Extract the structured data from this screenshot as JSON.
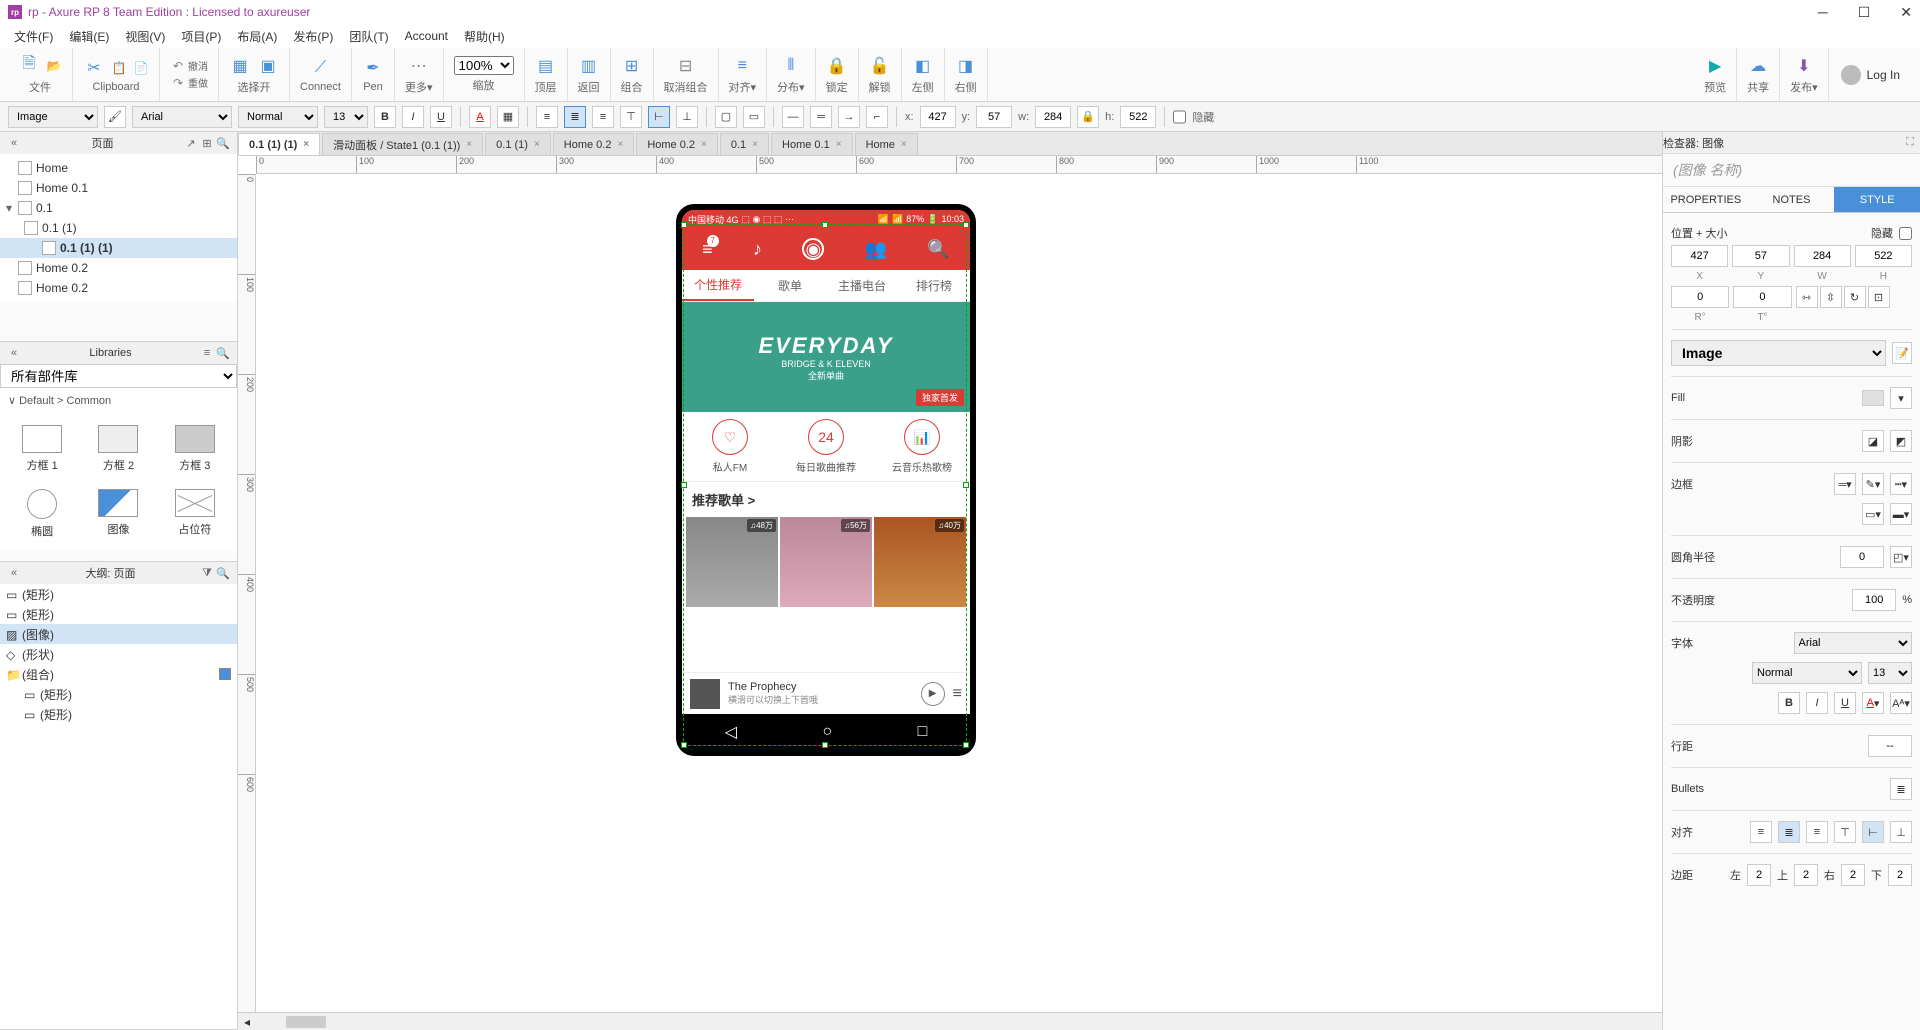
{
  "title": "rp - Axure RP 8 Team Edition : Licensed to axureuser",
  "menu": [
    "文件(F)",
    "编辑(E)",
    "视图(V)",
    "项目(P)",
    "布局(A)",
    "发布(P)",
    "团队(T)",
    "Account",
    "帮助(H)"
  ],
  "toolbar": {
    "groups": [
      {
        "label": "文件"
      },
      {
        "label": "Clipboard"
      },
      {
        "label": "选择开"
      },
      {
        "label": "Connect"
      },
      {
        "label": "Pen"
      },
      {
        "label": "更多▾"
      },
      {
        "label": "缩放"
      },
      {
        "label": "顶层"
      },
      {
        "label": "返回"
      },
      {
        "label": "组合"
      },
      {
        "label": "取消组合"
      },
      {
        "label": "对齐▾"
      },
      {
        "label": "分布▾"
      },
      {
        "label": "锁定"
      },
      {
        "label": "解锁"
      },
      {
        "label": "左侧"
      },
      {
        "label": "右侧"
      },
      {
        "label": "预览"
      },
      {
        "label": "共享"
      },
      {
        "label": "发布▾"
      }
    ],
    "zoom": "100%",
    "login": "Log In",
    "undo": "撤消",
    "redo": "重做"
  },
  "stylebar": {
    "widget": "Image",
    "font": "Arial",
    "weight": "Normal",
    "size": "13",
    "x": "427",
    "y": "57",
    "w": "284",
    "h": "522",
    "xlbl": "x:",
    "ylbl": "y:",
    "wlbl": "w:",
    "hlbl": "h:",
    "lock": "🔒",
    "hide": "隐藏"
  },
  "pages": {
    "title": "页面",
    "nodes": [
      {
        "label": "Home",
        "indent": 0
      },
      {
        "label": "Home 0.1",
        "indent": 0
      },
      {
        "label": "0.1",
        "indent": 0,
        "arrow": "▾"
      },
      {
        "label": "0.1 (1)",
        "indent": 1
      },
      {
        "label": "0.1 (1) (1)",
        "indent": 2,
        "selected": true
      },
      {
        "label": "Home 0.2",
        "indent": 0
      },
      {
        "label": "Home 0.2",
        "indent": 0
      }
    ]
  },
  "libraries": {
    "title": "Libraries",
    "select": "所有部件库",
    "section": "Default > Common",
    "items": [
      {
        "lbl": "方框 1",
        "cls": ""
      },
      {
        "lbl": "方框 2",
        "cls": "gray"
      },
      {
        "lbl": "方框 3",
        "cls": "dark"
      },
      {
        "lbl": "椭圆",
        "cls": "circle"
      },
      {
        "lbl": "图像",
        "cls": "image"
      },
      {
        "lbl": "占位符",
        "cls": "placeholder"
      }
    ]
  },
  "outline": {
    "title": "大纲: 页面",
    "nodes": [
      {
        "label": "(矩形)"
      },
      {
        "label": "(矩形)"
      },
      {
        "label": "(图像)",
        "selected": true
      },
      {
        "label": "(形状)"
      },
      {
        "label": "(组合)",
        "chk": true
      },
      {
        "label": "(矩形)",
        "indent": 1
      },
      {
        "label": "(矩形)",
        "indent": 1
      }
    ]
  },
  "tabs": [
    {
      "label": "0.1 (1) (1)",
      "active": true
    },
    {
      "label": "滑动面板 / State1 (0.1 (1))"
    },
    {
      "label": "0.1 (1)"
    },
    {
      "label": "Home 0.2"
    },
    {
      "label": "Home 0.2"
    },
    {
      "label": "0.1"
    },
    {
      "label": "Home 0.1"
    },
    {
      "label": "Home"
    }
  ],
  "rulerH": [
    "0",
    "100",
    "200",
    "300",
    "400",
    "500",
    "600",
    "700",
    "800",
    "900",
    "1000",
    "1100"
  ],
  "rulerV": [
    "0",
    "100",
    "200",
    "300",
    "400",
    "500",
    "600"
  ],
  "mock": {
    "status": {
      "carrier": "中国移动 4G",
      "battery": "87%",
      "time": "10:03"
    },
    "badge": "7",
    "tabs": [
      "个性推荐",
      "歌单",
      "主播电台",
      "排行榜"
    ],
    "banner": {
      "title": "EVERYDAY",
      "sub1": "BRIDGE & K ELEVEN",
      "sub2": "全新单曲",
      "tag": "独家首发"
    },
    "quick": [
      {
        "icon": "♡",
        "lbl": "私人FM"
      },
      {
        "icon": "24",
        "lbl": "每日歌曲推荐"
      },
      {
        "icon": "📊",
        "lbl": "云音乐热歌榜"
      }
    ],
    "section": "推荐歌单 >",
    "thumbs": [
      "♫48万",
      "♫56万",
      "♫40万"
    ],
    "player": {
      "song": "The Prophecy",
      "sub": "横滑可以切换上下首哦"
    }
  },
  "inspector": {
    "title": "检查器: 图像",
    "name": "(图像 名称)",
    "tabs": [
      "PROPERTIES",
      "NOTES",
      "STYLE"
    ],
    "pos": "位置 + 大小",
    "hide": "隐藏",
    "x": "427",
    "y": "57",
    "w": "284",
    "h": "522",
    "r": "0",
    "t": "0",
    "xlbl": "X",
    "ylbl": "Y",
    "wlbl": "W",
    "hlbl": "H",
    "rlbl": "R°",
    "tlbl": "T°",
    "styleSel": "Image",
    "fill": "Fill",
    "shadow": "阴影",
    "border": "边框",
    "radius": "圆角半径",
    "radiusV": "0",
    "opacity": "不透明度",
    "opacityV": "100",
    "pct": "%",
    "font": "字体",
    "fontV": "Arial",
    "weightV": "Normal",
    "sizeV": "13",
    "lineheight": "行距",
    "lhV": "--",
    "bullets": "Bullets",
    "align": "对齐",
    "margin": "边距",
    "ml": "左",
    "mt": "上",
    "mr": "右",
    "mb": "下",
    "mv": "2"
  }
}
